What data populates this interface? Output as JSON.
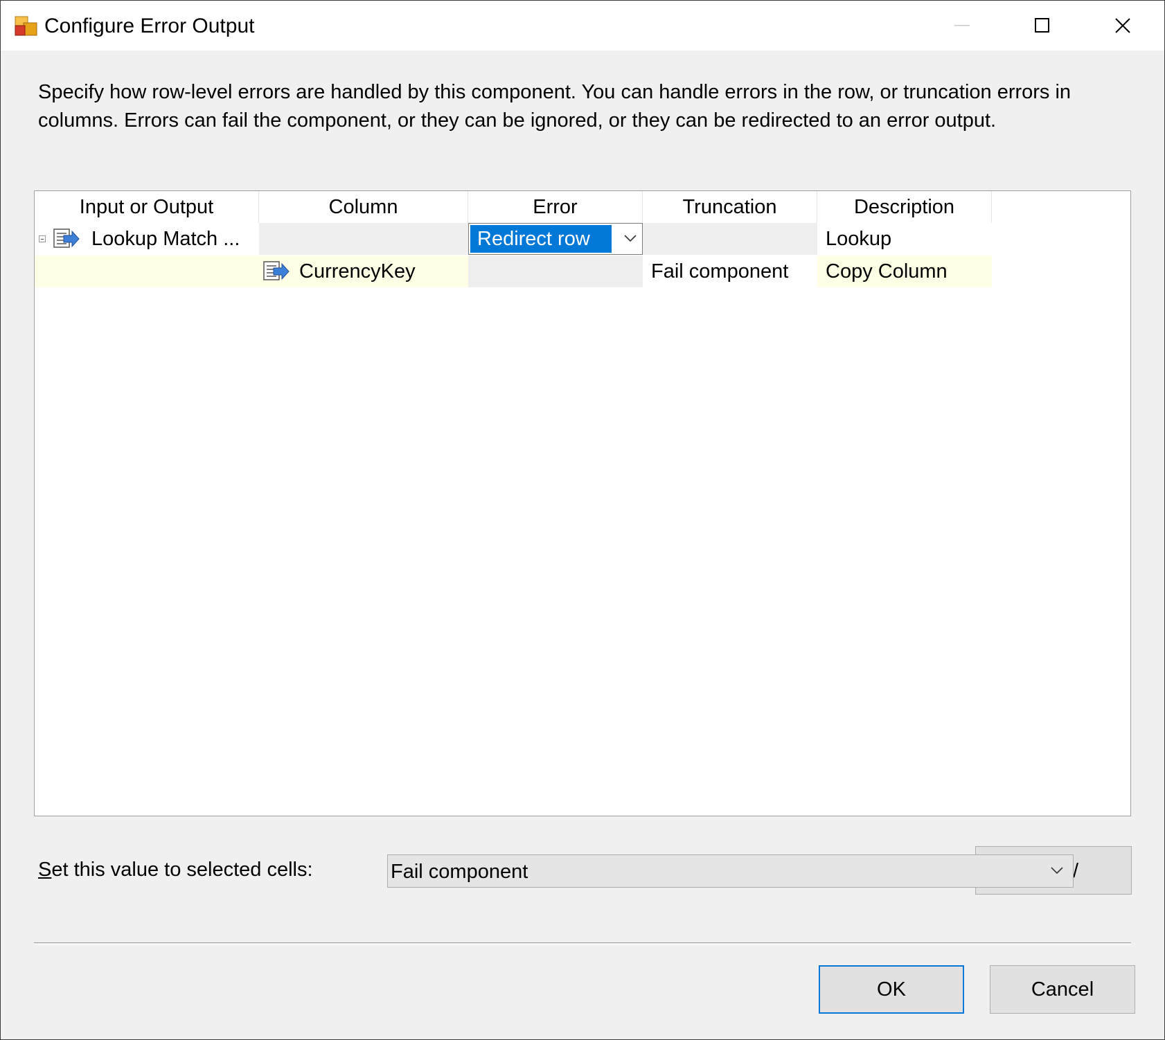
{
  "window": {
    "title": "Configure Error Output",
    "icon": "ssis-component-icon"
  },
  "title_buttons": {
    "minimize": "minimize-icon",
    "maximize": "maximize-icon",
    "close": "close-icon"
  },
  "description": "Specify how row-level errors are handled by this component. You can handle errors in the row, or truncation errors in columns. Errors can fail the component, or they can be ignored, or they can be redirected to an error output.",
  "grid": {
    "columns": [
      "Input or Output",
      "Column",
      "Error",
      "Truncation",
      "Description"
    ],
    "rows": [
      {
        "input_or_output": "Lookup Match ...",
        "column": "",
        "error": "Redirect row",
        "truncation": "",
        "description": "Lookup"
      },
      {
        "input_or_output": "",
        "column": "CurrencyKey",
        "error": "",
        "truncation": "Fail component",
        "description": "Copy Column"
      }
    ]
  },
  "set_value": {
    "label_prefix": "S",
    "label_rest": "et this value to selected cells:",
    "selected": "Fail component",
    "apply_fragment": "/"
  },
  "buttons": {
    "ok": "OK",
    "cancel": "Cancel"
  },
  "colors": {
    "selection": "#0078d7",
    "highlight_row": "#ffffe5",
    "window_bg": "#f0f0f0"
  }
}
